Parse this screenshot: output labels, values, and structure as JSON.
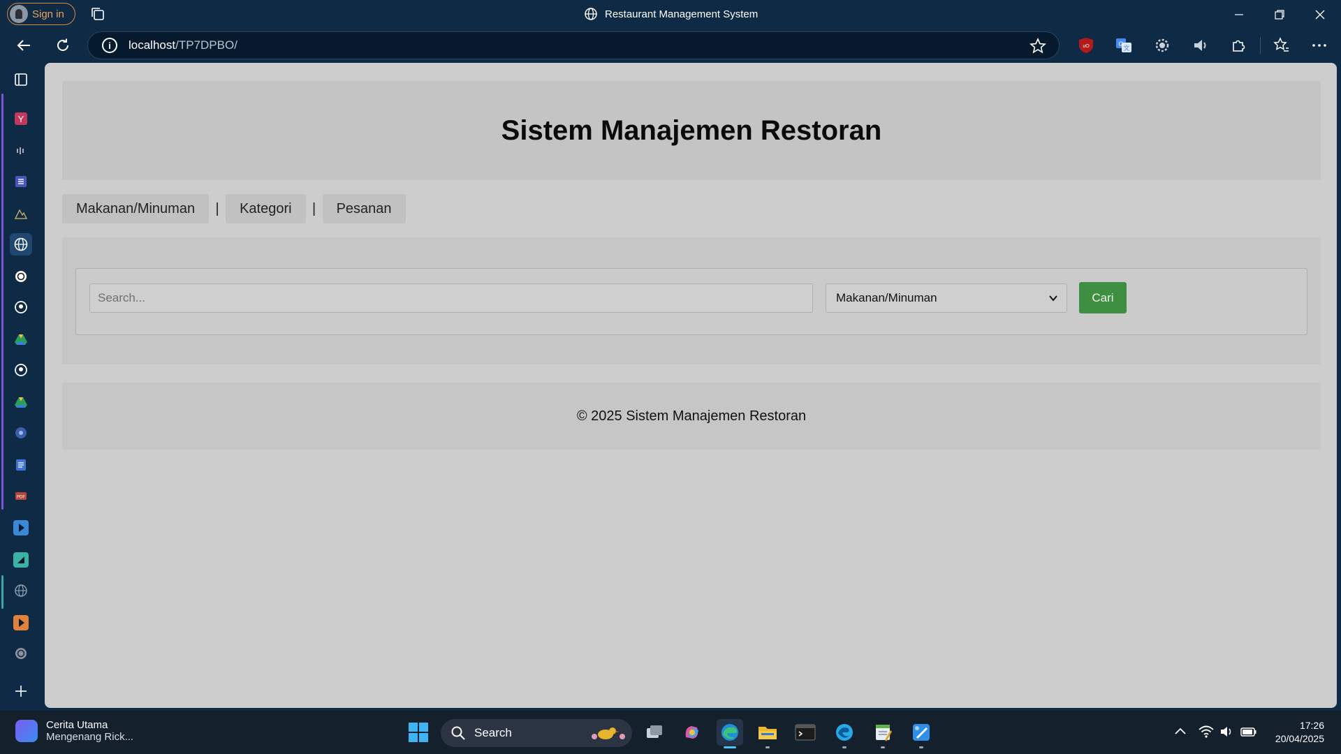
{
  "browser": {
    "signin_label": "Sign in",
    "window_title": "Restaurant Management System",
    "url_host": "localhost",
    "url_path": "/TP7DPBO/"
  },
  "page": {
    "title": "Sistem Manajemen Restoran",
    "nav": {
      "items": [
        "Makanan/Minuman",
        "Kategori",
        "Pesanan"
      ],
      "separator": "|"
    },
    "search": {
      "placeholder": "Search...",
      "select_value": "Makanan/Minuman",
      "button_label": "Cari"
    },
    "footer": "© 2025 Sistem Manajemen Restoran"
  },
  "taskbar": {
    "news_title": "Cerita Utama",
    "news_subtitle": "Mengenang Rick...",
    "search_label": "Search",
    "time": "17:26",
    "date": "20/04/2025"
  },
  "colors": {
    "accent_button": "#3f8f43",
    "browser_chrome": "#0f2a44",
    "page_bg": "#cdcdcd"
  }
}
